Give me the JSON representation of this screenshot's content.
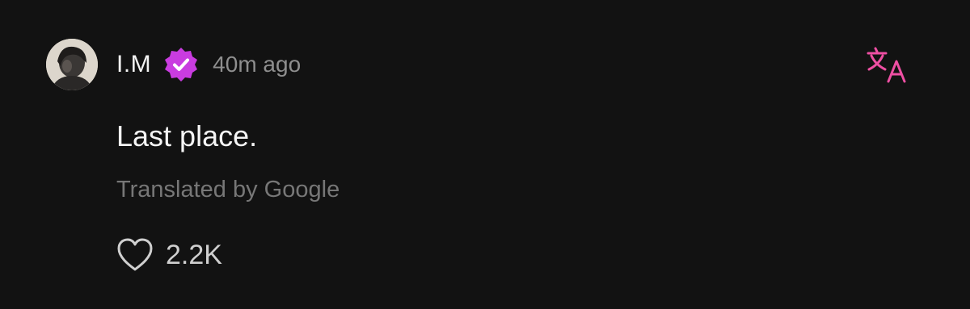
{
  "post": {
    "author": {
      "name": "I.M",
      "verified": true,
      "verified_color": "#c93ce0",
      "avatar_icon": "profile-photo"
    },
    "timestamp": "40m ago",
    "message": "Last place.",
    "translation_note": "Translated by Google",
    "likes": {
      "icon": "heart-icon",
      "count": "2.2K"
    },
    "translate_icon": "translate-icon",
    "accent_color": "#ee4fa3"
  }
}
